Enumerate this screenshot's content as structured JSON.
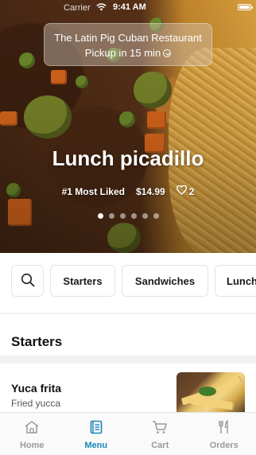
{
  "status_bar": {
    "carrier": "Carrier",
    "time": "9:41 AM"
  },
  "restaurant": {
    "name": "The Latin Pig Cuban Restaurant",
    "pickup": "Pickup in 15 min"
  },
  "featured": {
    "title": "Lunch picadillo",
    "rank": "#1 Most Liked",
    "price": "$14.99",
    "likes": "2",
    "slide_count": 6,
    "active_slide": 1
  },
  "categories": [
    "Starters",
    "Sandwiches",
    "Lunch"
  ],
  "section": {
    "title": "Starters"
  },
  "menu_items": [
    {
      "name": "Yuca frita",
      "description": "Fried yucca"
    }
  ],
  "tabs": [
    {
      "label": "Home",
      "icon": "home-icon",
      "active": false
    },
    {
      "label": "Menu",
      "icon": "menu-book-icon",
      "active": true
    },
    {
      "label": "Cart",
      "icon": "cart-icon",
      "active": false
    },
    {
      "label": "Orders",
      "icon": "utensils-icon",
      "active": false
    }
  ],
  "colors": {
    "accent": "#1c86b8",
    "inactive": "#9a9a9a"
  }
}
